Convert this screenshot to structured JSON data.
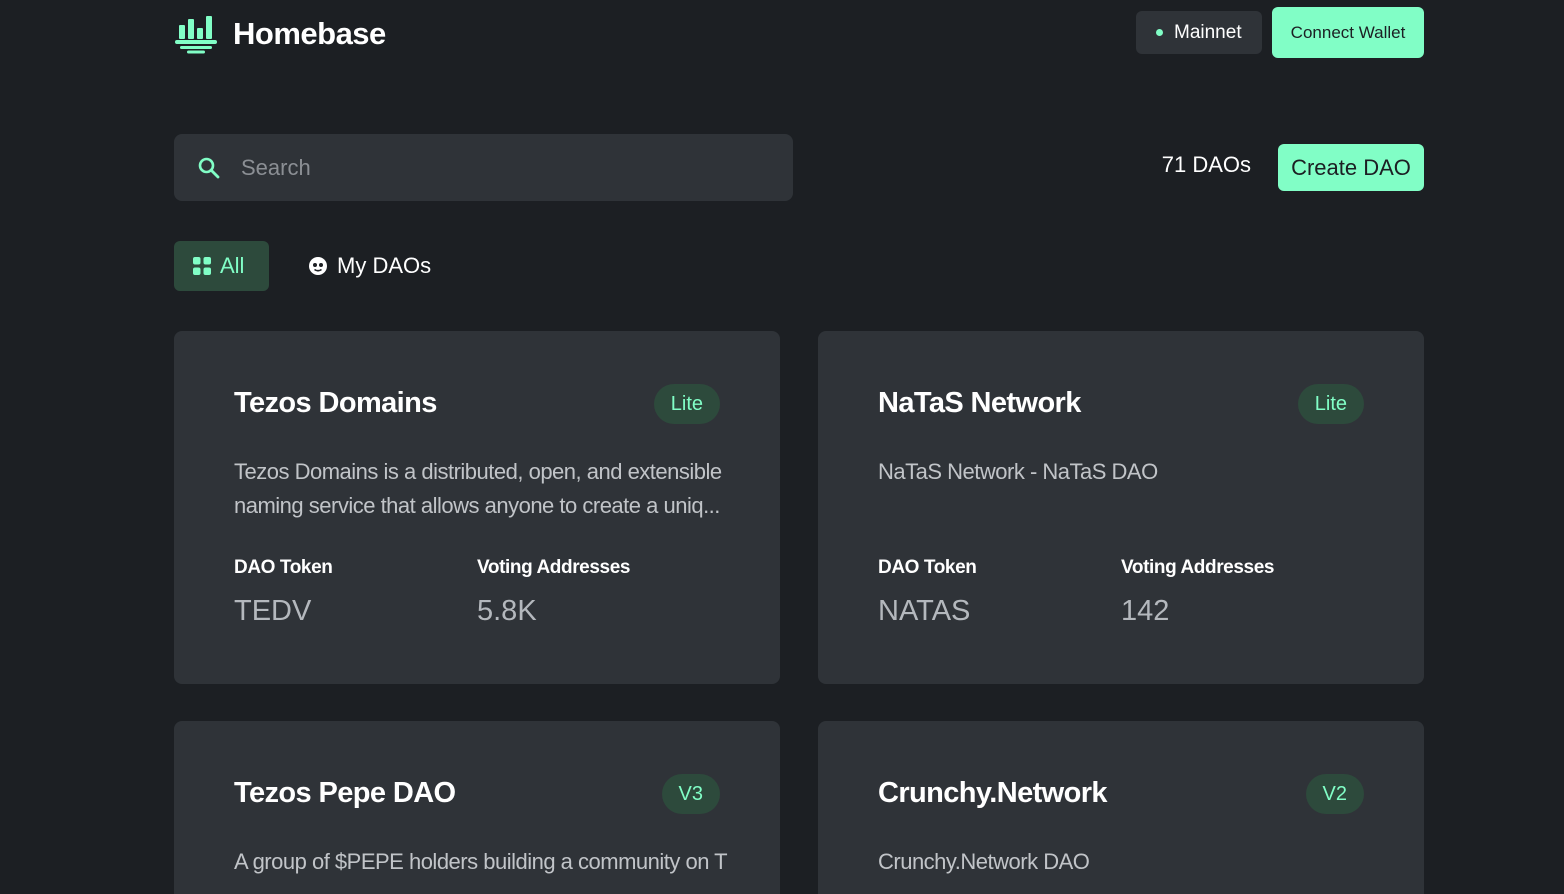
{
  "header": {
    "brand_name": "Homebase",
    "network_label": "Mainnet",
    "connect_wallet_label": "Connect Wallet"
  },
  "toolbar": {
    "search_placeholder": "Search",
    "dao_count": "71 DAOs",
    "create_dao_label": "Create DAO"
  },
  "tabs": [
    {
      "label": "All",
      "icon": "grid-icon",
      "active": true
    },
    {
      "label": "My DAOs",
      "icon": "user-circle-icon",
      "active": false
    }
  ],
  "stat_labels": {
    "token": "DAO Token",
    "voters": "Voting Addresses"
  },
  "cards": [
    {
      "title": "Tezos Domains",
      "badge": "Lite",
      "description": "Tezos Domains is a distributed, open, and extensible naming service that allows anyone to create a uniq...",
      "token": "TEDV",
      "voters": "5.8K"
    },
    {
      "title": "NaTaS Network",
      "badge": "Lite",
      "description": "NaTaS Network - NaTaS DAO",
      "token": "NATAS",
      "voters": "142"
    },
    {
      "title": "Tezos Pepe DAO",
      "badge": "V3",
      "description": "A group of $PEPE holders building a community on T",
      "token": "",
      "voters": ""
    },
    {
      "title": "Crunchy.Network",
      "badge": "V2",
      "description": "Crunchy.Network DAO",
      "token": "",
      "voters": ""
    }
  ],
  "colors": {
    "background": "#1c1f23",
    "surface": "#2f3338",
    "accent": "#81fec6",
    "badge_bg": "#2d4a3c"
  }
}
